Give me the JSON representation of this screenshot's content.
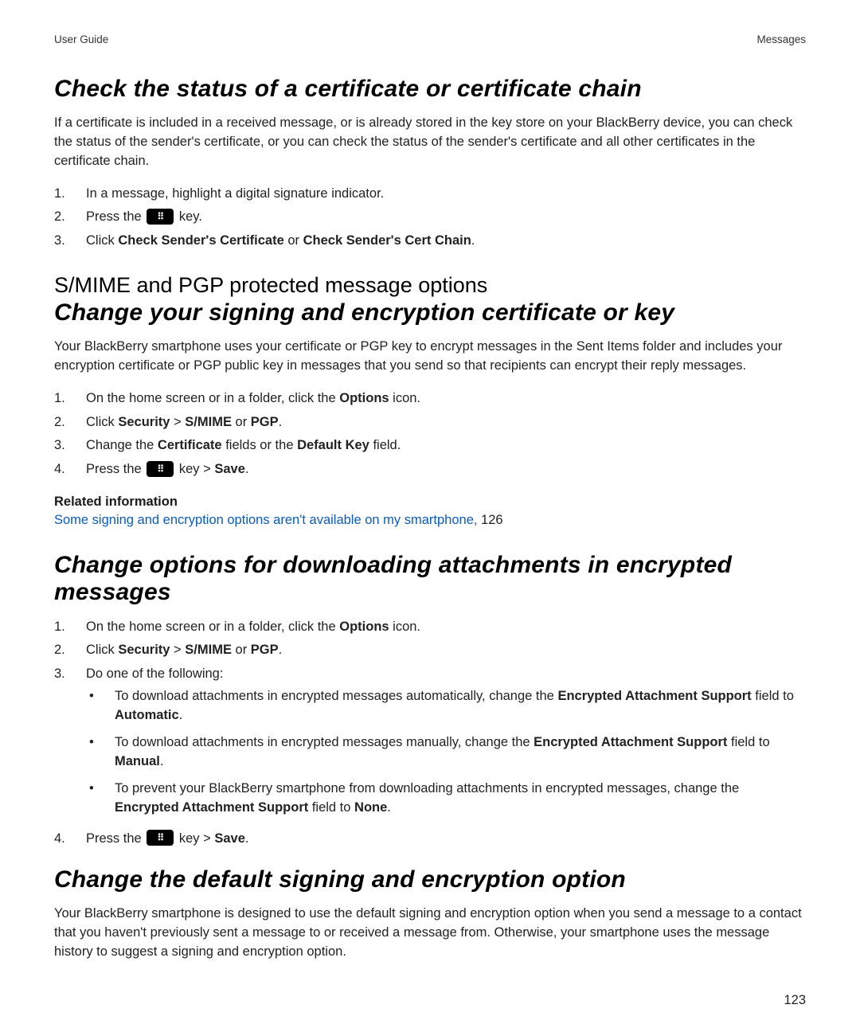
{
  "header": {
    "left": "User Guide",
    "right": "Messages"
  },
  "section1": {
    "heading": "Check the status of a certificate or certificate chain",
    "intro": "If a certificate is included in a received message, or is already stored in the key store on your BlackBerry device, you can check the status of the sender's certificate, or you can check the status of the sender's certificate and all other certificates in the certificate chain.",
    "steps": {
      "n1": "1.",
      "s1": "In a message, highlight a digital signature indicator.",
      "n2": "2.",
      "s2a": "Press the ",
      "s2b": " key.",
      "n3": "3.",
      "s3_pre": "Click ",
      "s3_b1": "Check Sender's Certificate",
      "s3_mid": " or ",
      "s3_b2": "Check Sender's Cert Chain",
      "s3_post": "."
    }
  },
  "section2": {
    "heading_plain": "S/MIME and PGP protected message options",
    "heading_italic": "Change your signing and encryption certificate or key",
    "intro": "Your BlackBerry smartphone uses your certificate or PGP key to encrypt messages in the Sent Items folder and includes your encryption certificate or PGP public key in messages that you send so that recipients can encrypt their reply messages.",
    "steps": {
      "n1": "1.",
      "s1_pre": "On the home screen or in a folder, click the ",
      "s1_b": "Options",
      "s1_post": " icon.",
      "n2": "2.",
      "s2_pre": "Click ",
      "s2_b1": "Security",
      "s2_mid1": " > ",
      "s2_b2": "S/MIME",
      "s2_mid2": " or ",
      "s2_b3": "PGP",
      "s2_post": ".",
      "n3": "3.",
      "s3_pre": "Change the ",
      "s3_b1": "Certificate",
      "s3_mid": " fields or the ",
      "s3_b2": "Default Key",
      "s3_post": " field.",
      "n4": "4.",
      "s4_pre": "Press the ",
      "s4_mid": " key > ",
      "s4_b": "Save",
      "s4_post": "."
    },
    "related_heading": "Related information",
    "related_link": "Some signing and encryption options aren't available on my smartphone,",
    "related_num": " 126"
  },
  "section3": {
    "heading": "Change options for downloading attachments in encrypted messages",
    "steps": {
      "n1": "1.",
      "s1_pre": "On the home screen or in a folder, click the ",
      "s1_b": "Options",
      "s1_post": " icon.",
      "n2": "2.",
      "s2_pre": "Click ",
      "s2_b1": "Security",
      "s2_mid1": " > ",
      "s2_b2": "S/MIME",
      "s2_mid2": " or ",
      "s2_b3": "PGP",
      "s2_post": ".",
      "n3": "3.",
      "s3": "Do one of the following:",
      "b1_pre": "To download attachments in encrypted messages automatically, change the ",
      "b1_b1": "Encrypted Attachment Support",
      "b1_mid": " field to ",
      "b1_b2": "Automatic",
      "b1_post": ".",
      "b2_pre": "To download attachments in encrypted messages manually, change the ",
      "b2_b1": "Encrypted Attachment Support",
      "b2_mid": " field to ",
      "b2_b2": "Manual",
      "b2_post": ".",
      "b3_pre": "To prevent your BlackBerry smartphone from downloading attachments in encrypted messages, change the ",
      "b3_b1": "Encrypted Attachment Support",
      "b3_mid": " field to ",
      "b3_b2": "None",
      "b3_post": ".",
      "n4": "4.",
      "s4_pre": "Press the ",
      "s4_mid": " key > ",
      "s4_b": "Save",
      "s4_post": "."
    }
  },
  "section4": {
    "heading": "Change the default signing and encryption option",
    "intro": "Your BlackBerry smartphone is designed to use the default signing and encryption option when you send a message to a contact that you haven't previously sent a message to or received a message from. Otherwise, your smartphone uses the message history to suggest a signing and encryption option."
  },
  "bb_glyph": "⠿",
  "page_number": "123"
}
